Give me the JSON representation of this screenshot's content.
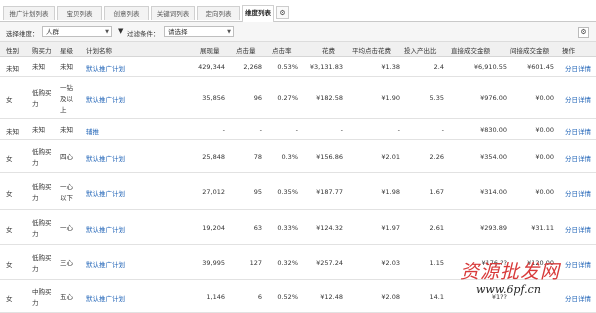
{
  "tabs": [
    {
      "label": "推广计划列表",
      "active": false
    },
    {
      "label": "宝贝列表",
      "active": false
    },
    {
      "label": "创意列表",
      "active": false
    },
    {
      "label": "关键词列表",
      "active": false
    },
    {
      "label": "定向列表",
      "active": false
    },
    {
      "label": "维度列表",
      "active": true
    }
  ],
  "tab_icon": "gear-icon",
  "filter": {
    "dimension_label": "选择维度：",
    "dimension_value": "人群",
    "funnel_icon": "funnel-icon",
    "condition_label": "过滤条件：",
    "condition_value": "请选择"
  },
  "columns": [
    "性别",
    "购买力",
    "星级",
    "计划名称",
    "展现量",
    "点击量",
    "点击率",
    "花费",
    "平均点击花费",
    "投入产出比",
    "直接成交金额",
    "间接成交金额",
    "操作"
  ],
  "rows": [
    {
      "gender": "未知",
      "purchase": [
        "未知"
      ],
      "star": [
        "未知"
      ],
      "plan": "默认推广计划",
      "impressions": "429,344",
      "clicks": "2,268",
      "ctr": "0.53%",
      "cost": "¥3,131.83",
      "cpc": "¥1.38",
      "roi": "2.4",
      "direct": "¥6,910.55",
      "indirect": "¥601.45",
      "action": "分日详情"
    },
    {
      "gender": "女",
      "purchase": [
        "低购买",
        "力"
      ],
      "star": [
        "一钻",
        "及以",
        "上"
      ],
      "plan": "默认推广计划",
      "impressions": "35,856",
      "clicks": "96",
      "ctr": "0.27%",
      "cost": "¥182.58",
      "cpc": "¥1.90",
      "roi": "5.35",
      "direct": "¥976.00",
      "indirect": "¥0.00",
      "action": "分日详情"
    },
    {
      "gender": "未知",
      "purchase": [
        "未知"
      ],
      "star": [
        "未知"
      ],
      "plan": "辅推",
      "impressions": "-",
      "clicks": "-",
      "ctr": "-",
      "cost": "-",
      "cpc": "-",
      "roi": "-",
      "direct": "¥830.00",
      "indirect": "¥0.00",
      "action": "分日详情"
    },
    {
      "gender": "女",
      "purchase": [
        "低购买",
        "力"
      ],
      "star": [
        "四心"
      ],
      "plan": "默认推广计划",
      "impressions": "25,848",
      "clicks": "78",
      "ctr": "0.3%",
      "cost": "¥156.86",
      "cpc": "¥2.01",
      "roi": "2.26",
      "direct": "¥354.00",
      "indirect": "¥0.00",
      "action": "分日详情"
    },
    {
      "gender": "女",
      "purchase": [
        "低购买",
        "力"
      ],
      "star": [
        "一心",
        "以下"
      ],
      "plan": "默认推广计划",
      "impressions": "27,012",
      "clicks": "95",
      "ctr": "0.35%",
      "cost": "¥187.77",
      "cpc": "¥1.98",
      "roi": "1.67",
      "direct": "¥314.00",
      "indirect": "¥0.00",
      "action": "分日详情"
    },
    {
      "gender": "女",
      "purchase": [
        "低购买",
        "力"
      ],
      "star": [
        "一心"
      ],
      "plan": "默认推广计划",
      "impressions": "19,204",
      "clicks": "63",
      "ctr": "0.33%",
      "cost": "¥124.32",
      "cpc": "¥1.97",
      "roi": "2.61",
      "direct": "¥293.89",
      "indirect": "¥31.11",
      "action": "分日详情"
    },
    {
      "gender": "女",
      "purchase": [
        "低购买",
        "力"
      ],
      "star": [
        "三心"
      ],
      "plan": "默认推广计划",
      "impressions": "39,995",
      "clicks": "127",
      "ctr": "0.32%",
      "cost": "¥257.24",
      "cpc": "¥2.03",
      "roi": "1.15",
      "direct": "¥176.??",
      "indirect": "¥120.00",
      "action": "分日详情"
    },
    {
      "gender": "女",
      "purchase": [
        "中购买",
        "力"
      ],
      "star": [
        "五心"
      ],
      "plan": "默认推广计划",
      "impressions": "1,146",
      "clicks": "6",
      "ctr": "0.52%",
      "cost": "¥12.48",
      "cpc": "¥2.08",
      "roi": "14.1",
      "direct": "¥1??",
      "indirect": "",
      "action": "分日详情"
    }
  ],
  "watermark": {
    "cn": "资源批发网",
    "url": "www.6pf.cn"
  }
}
